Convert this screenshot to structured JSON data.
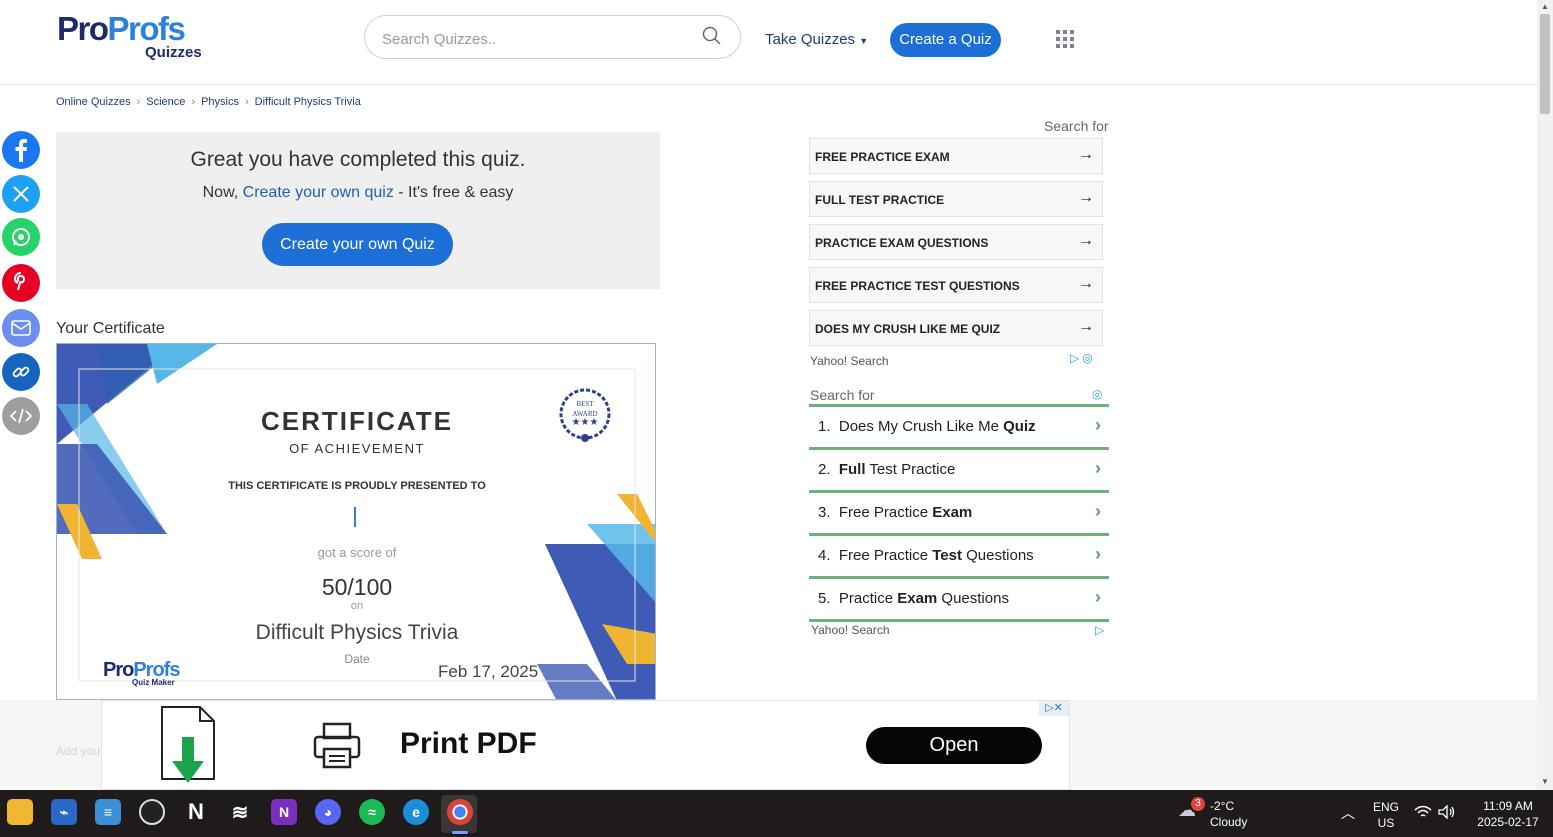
{
  "header": {
    "logo_main_a": "Pro",
    "logo_main_b": "Profs",
    "logo_sub": "Quizzes",
    "search_placeholder": "Search Quizzes..",
    "take_quizzes": "Take Quizzes",
    "create_quiz": "Create a Quiz"
  },
  "breadcrumb": [
    "Online Quizzes",
    "Science",
    "Physics",
    "Difficult Physics Trivia"
  ],
  "completion": {
    "title": "Great you have completed this quiz.",
    "sub_prefix": "Now, ",
    "sub_link": "Create your own quiz",
    "sub_suffix": " - It's free & easy",
    "button": "Create your own Quiz"
  },
  "certificate": {
    "heading": "Your Certificate",
    "title": "CERTIFICATE",
    "subtitle": "OF ACHIEVEMENT",
    "presented": "THIS CERTIFICATE IS PROUDLY PRESENTED TO",
    "score_text": "got a score of",
    "score": "50/100",
    "on": "on",
    "quiz_name": "Difficult Physics Trivia",
    "date_label": "Date",
    "date": "Feb 17, 2025",
    "logo_a": "Pro",
    "logo_b": "Profs",
    "logo_sub": "Quiz Maker",
    "badge_line1": "BEST",
    "badge_line2": "AWARD"
  },
  "ads_top": {
    "search_for": "Search for",
    "items": [
      "FREE PRACTICE EXAM",
      "FULL TEST PRACTICE",
      "PRACTICE EXAM QUESTIONS",
      "FREE PRACTICE TEST QUESTIONS",
      "DOES MY CRUSH LIKE ME QUIZ"
    ],
    "arrow": "→",
    "provider": "Yahoo! Search"
  },
  "ads_list": {
    "search_for": "Search for",
    "items": [
      {
        "num": "1.",
        "pre": "Does My Crush Like Me ",
        "bold": "Quiz",
        "post": ""
      },
      {
        "num": "2.",
        "pre": "",
        "bold": "Full",
        "post": " Test Practice"
      },
      {
        "num": "3.",
        "pre": "Free Practice ",
        "bold": "Exam",
        "post": ""
      },
      {
        "num": "4.",
        "pre": "Free Practice ",
        "bold": "Test",
        "post": " Questions"
      },
      {
        "num": "5.",
        "pre": "Practice ",
        "bold": "Exam",
        "post": " Questions"
      }
    ],
    "provider": "Yahoo! Search"
  },
  "bottom_ad": {
    "title": "Print PDF",
    "button": "Open",
    "close": "▷✕",
    "faded": "Add you"
  },
  "taskbar": {
    "weather_badge": "3",
    "temp": "-2°C",
    "condition": "Cloudy",
    "lang1": "ENG",
    "lang2": "US",
    "time": "11:09 AM",
    "date": "2025-02-17"
  },
  "colors": {
    "brand_dark": "#1f2a6b",
    "brand_blue": "#1c6fd6",
    "ad_green": "#6eb07c"
  }
}
